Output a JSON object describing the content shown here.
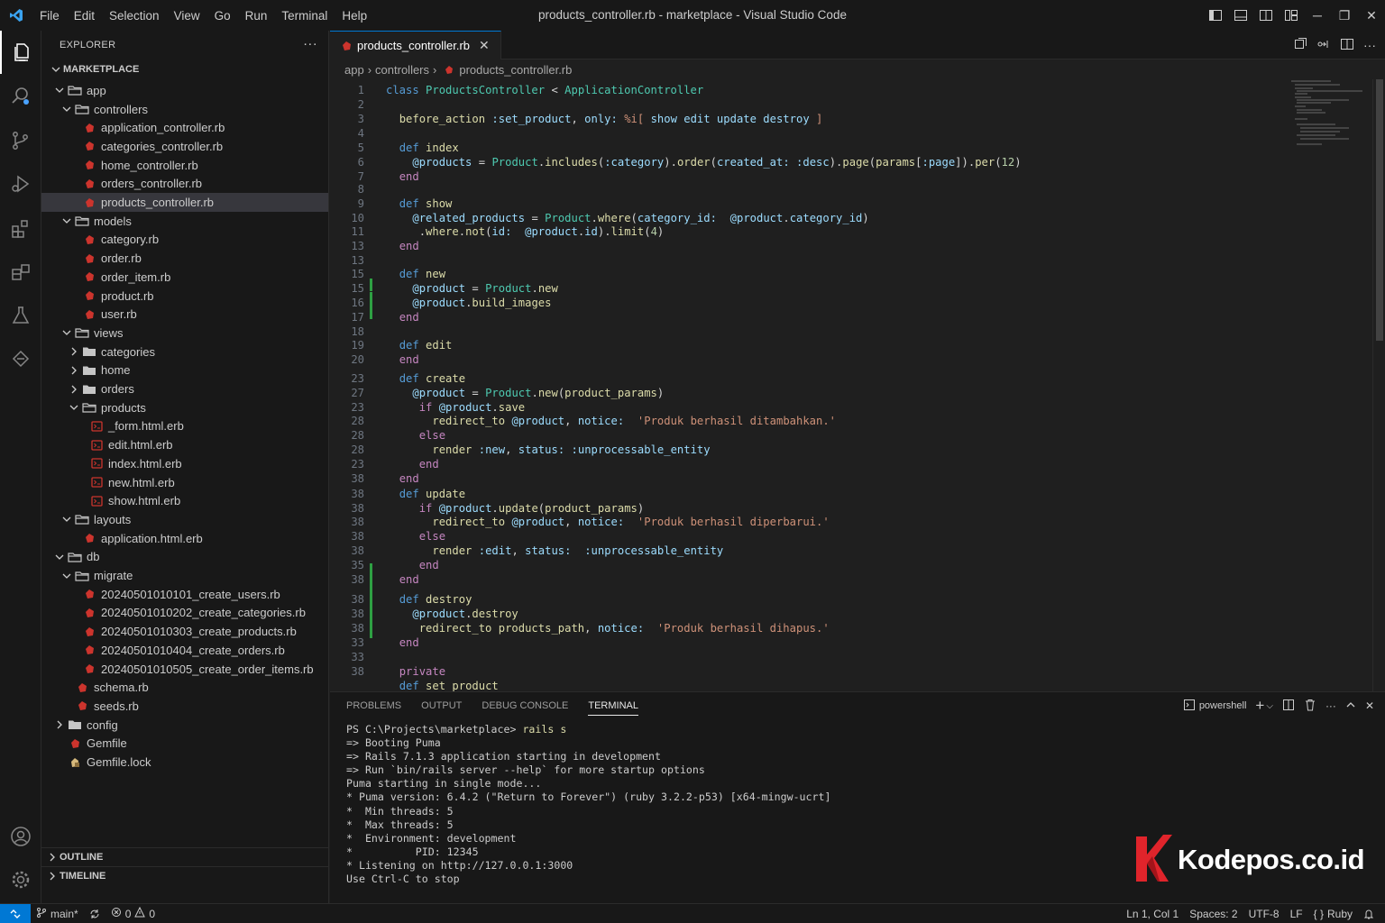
{
  "titlebar": {
    "menu": [
      "File",
      "Edit",
      "Selection",
      "View",
      "Go",
      "Run",
      "Terminal",
      "Help"
    ],
    "title": "products_controller.rb - marketplace - Visual Studio Code"
  },
  "sidebar": {
    "header": "EXPLORER",
    "root": "MARKETPLACE",
    "tree": [
      {
        "label": "app",
        "kind": "folder-open"
      },
      {
        "label": "controllers",
        "kind": "folder-open"
      },
      {
        "label": "application_controller.rb",
        "kind": "ruby"
      },
      {
        "label": "categories_controller.rb",
        "kind": "ruby"
      },
      {
        "label": "home_controller.rb",
        "kind": "ruby"
      },
      {
        "label": "orders_controller.rb",
        "kind": "ruby"
      },
      {
        "label": "products_controller.rb",
        "kind": "ruby"
      },
      {
        "label": "models",
        "kind": "folder-open"
      },
      {
        "label": "category.rb",
        "kind": "ruby"
      },
      {
        "label": "order.rb",
        "kind": "ruby"
      },
      {
        "label": "order_item.rb",
        "kind": "ruby"
      },
      {
        "label": "product.rb",
        "kind": "ruby"
      },
      {
        "label": "user.rb",
        "kind": "ruby"
      },
      {
        "label": "views",
        "kind": "folder-open"
      },
      {
        "label": "categories",
        "kind": "folder"
      },
      {
        "label": "home",
        "kind": "folder"
      },
      {
        "label": "orders",
        "kind": "folder"
      },
      {
        "label": "products",
        "kind": "folder-open"
      },
      {
        "label": "_form.html.erb",
        "kind": "erb"
      },
      {
        "label": "edit.html.erb",
        "kind": "erb"
      },
      {
        "label": "index.html.erb",
        "kind": "erb"
      },
      {
        "label": "new.html.erb",
        "kind": "erb"
      },
      {
        "label": "show.html.erb",
        "kind": "erb"
      },
      {
        "label": "layouts",
        "kind": "folder-open"
      },
      {
        "label": "application.html.erb",
        "kind": "ruby"
      },
      {
        "label": "db",
        "kind": "folder-open"
      },
      {
        "label": "migrate",
        "kind": "folder-open"
      },
      {
        "label": "20240501010101_create_users.rb",
        "kind": "ruby"
      },
      {
        "label": "20240501010202_create_categories.rb",
        "kind": "ruby"
      },
      {
        "label": "20240501010303_create_products.rb",
        "kind": "ruby"
      },
      {
        "label": "20240501010404_create_orders.rb",
        "kind": "ruby"
      },
      {
        "label": "20240501010505_create_order_items.rb",
        "kind": "ruby"
      },
      {
        "label": "schema.rb",
        "kind": "ruby"
      },
      {
        "label": "seeds.rb",
        "kind": "ruby"
      },
      {
        "label": "config",
        "kind": "folder"
      },
      {
        "label": "Gemfile",
        "kind": "ruby"
      },
      {
        "label": "Gemfile.lock",
        "kind": "lock"
      }
    ],
    "outline": "OUTLINE",
    "timeline": "TIMELINE"
  },
  "editor": {
    "tab_label": "products_controller.rb",
    "close_glyph": "✕",
    "breadcrumb": [
      "app",
      "controllers",
      "products_controller.rb"
    ],
    "line_numbers": [
      "1",
      "2",
      "3",
      "4",
      "5",
      "6",
      "7",
      "8",
      "9",
      "10",
      "11",
      "13",
      "13",
      "15",
      "15",
      "16",
      "17",
      "18",
      "19",
      "20",
      "23",
      "27",
      "23",
      "28",
      "28",
      "28",
      "23",
      "38",
      "38",
      "38",
      "38",
      "38",
      "38",
      "35",
      "38",
      "38",
      "38",
      "38",
      "33",
      "33",
      "38"
    ]
  },
  "panel": {
    "tabs": [
      "PROBLEMS",
      "OUTPUT",
      "DEBUG CONSOLE",
      "TERMINAL"
    ],
    "shell": "powershell",
    "terminal": {
      "prompt": "PS C:\\Projects\\marketplace> ",
      "command": "rails s",
      "output": [
        "=> Booting Puma",
        "=> Rails 7.1.3 application starting in development",
        "=> Run `bin/rails server --help` for more startup options",
        "Puma starting in single mode...",
        "* Puma version: 6.4.2 (\"Return to Forever\") (ruby 3.2.2-p53) [x64-mingw-ucrt]",
        "*  Min threads: 5",
        "*  Max threads: 5",
        "*  Environment: development",
        "*          PID: 12345",
        "* Listening on http://127.0.0.1:3000",
        "Use Ctrl-C to stop"
      ]
    }
  },
  "watermark": {
    "text": "Kodepos.co.id",
    "logo_color": "#e0242b"
  },
  "statusbar": {
    "branch": "main*",
    "errors": "0",
    "warnings": "0",
    "position": "Ln 1, Col 1",
    "spaces": "Spaces: 2",
    "encoding": "UTF-8",
    "eol": "LF",
    "language": "Ruby"
  },
  "colors": {
    "accent": "#0078d4",
    "ruby_icon": "#cc342d",
    "folder_icon": "#c5c5c5",
    "git_added": "#2ea043"
  }
}
